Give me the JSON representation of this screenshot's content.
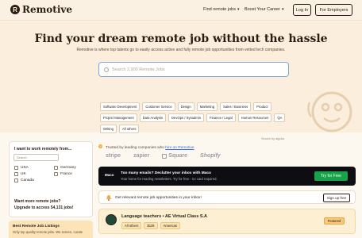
{
  "header": {
    "logo_text": "Remotive",
    "nav_find_jobs": "Find remote jobs",
    "nav_boost_career": "Boost Your Career",
    "login_label": "Log In",
    "employers_label": "For Employers"
  },
  "hero": {
    "title": "Find your dream remote job without the hassle",
    "subtitle": "Remotive is where top talents go to easily access active and fully remote job opportunities from vetted tech companies.",
    "search_placeholder": "Search 2,900 Remote Jobs",
    "tags_row1": [
      "Software Development",
      "Customer Service",
      "Design",
      "Marketing",
      "Sales / Business",
      "Product"
    ],
    "tags_row2": [
      "Project Management",
      "Data Analysis",
      "DevOps / Sysadmin",
      "Finance / Legal",
      "Human Resources",
      "QA"
    ],
    "tags_row3": [
      "Writing",
      "All others"
    ],
    "search_by": "Search by algolia"
  },
  "filter": {
    "title": "I want to work remotely from...",
    "search_placeholder": "Search",
    "countries_col1": [
      "USA",
      "UK",
      "Canada"
    ],
    "countries_col2": [
      "Germany",
      "France"
    ],
    "more_line1": "Want more remote jobs?",
    "more_line2": "Upgrade to access 54,131 jobs!"
  },
  "promo": {
    "title": "Best Remote Job Listings",
    "text": "Only top quality remote jobs. We screen, curate"
  },
  "trusted": {
    "text_before": "Trusted by leading companies who ",
    "link": "hire on Remotive",
    "logos": [
      "stripe",
      "zapier",
      "Square",
      "Shopify"
    ]
  },
  "maco": {
    "logo": "Maco",
    "title": "Too many emails? Declutter your inbox with Maco",
    "text": "Your home for reading newsletters. Try for free - no card required.",
    "button": "Try for Free"
  },
  "alert": {
    "text": "Get relevant remote job opportunities in your inbox!",
    "button": "Sign up free"
  },
  "job": {
    "title": "Language teachers • AE Virtual Class S.A",
    "chips": [
      "All others",
      "$10k",
      "Americas"
    ],
    "badge": "Featured"
  },
  "colors": {
    "background": "#fcf8f0",
    "hero": "#fbeedd",
    "text": "#2b1d12",
    "cta_green": "#16a34a",
    "featured": "#f7c77a"
  }
}
